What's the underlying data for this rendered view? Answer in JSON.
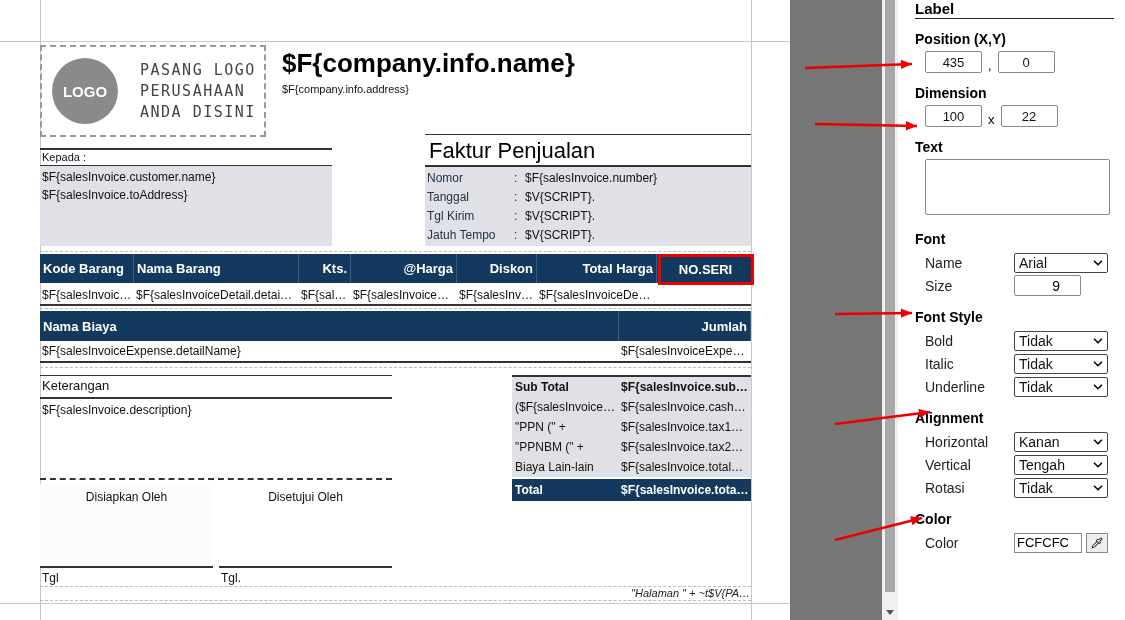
{
  "report": {
    "logo": {
      "badge": "LOGO",
      "lines": [
        "PASANG LOGO",
        "PERUSAHAAN",
        "ANDA DISINI"
      ]
    },
    "company": {
      "name": "$F{company.info.name}",
      "address": "$F{company.info.address}"
    },
    "recipient": {
      "label": "Kepada :",
      "lines": [
        "$F{salesInvoice.customer.name}",
        "$F{salesInvoice.toAddress}"
      ]
    },
    "invoice": {
      "title": "Faktur Penjualan",
      "fields": [
        {
          "label": "Nomor",
          "separator": ":",
          "value": "$F{salesInvoice.number}"
        },
        {
          "label": "Tanggal",
          "separator": ":",
          "value": "$V{SCRIPT}."
        },
        {
          "label": "Tgl Kirim",
          "separator": ":",
          "value": "$V{SCRIPT}."
        },
        {
          "label": "Jatuh Tempo",
          "separator": ":",
          "value": "$V{SCRIPT}."
        }
      ]
    },
    "detail_table": {
      "columns": [
        {
          "label": "Kode Barang",
          "kind": "text",
          "highlighted": false
        },
        {
          "label": "Nama Barang",
          "kind": "text",
          "highlighted": false
        },
        {
          "label": "Kts.",
          "kind": "amount",
          "highlighted": false
        },
        {
          "label": "@Harga",
          "kind": "amount",
          "highlighted": false
        },
        {
          "label": "Diskon",
          "kind": "amount",
          "highlighted": false
        },
        {
          "label": "Total Harga",
          "kind": "amount",
          "highlighted": false
        },
        {
          "label": "NO.SERI",
          "kind": "serial",
          "highlighted": true
        }
      ],
      "row": [
        "$F{salesInvoic…",
        "$F{salesInvoiceDetail.detai…",
        "$F{sal…",
        "$F{salesInvoice…",
        "$F{salesInv…",
        "$F{salesInvoiceDe…"
      ]
    },
    "expense_table": {
      "columns": [
        {
          "label": "Nama Biaya",
          "kind": "text"
        },
        {
          "label": "Jumlah",
          "kind": "amount"
        }
      ],
      "row": [
        "$F{salesInvoiceExpense.detailName}",
        "$F{salesInvoiceExpe…"
      ]
    },
    "notes": {
      "label": "Keterangan",
      "value": "$F{salesInvoice.description}"
    },
    "signatures": [
      {
        "title": "Disiapkan Oleh",
        "date_label": "Tgl"
      },
      {
        "title": "Disetujui Oleh",
        "date_label": "Tgl."
      }
    ],
    "totals": [
      {
        "kind": "bold",
        "label": "Sub Total",
        "value": "$F{salesInvoice.sub…"
      },
      {
        "kind": "plain",
        "label": "($F{salesInvoice…",
        "value": "$F{salesInvoice.cash…"
      },
      {
        "kind": "plain",
        "label": "\"PPN (\" +",
        "value": "$F{salesInvoice.tax1…"
      },
      {
        "kind": "plain",
        "label": "\"PPNBM (\" +",
        "value": "$F{salesInvoice.tax2…"
      },
      {
        "kind": "plain",
        "label": "Biaya Lain-lain",
        "value": "$F{salesInvoice.total…"
      },
      {
        "kind": "total",
        "label": "Total",
        "value": "$F{salesInvoice.tota…"
      }
    ],
    "footer": "\"Halaman \" +  ~t$V{PA…"
  },
  "properties": {
    "title": "Label",
    "sections": [
      {
        "kind": "pair",
        "heading": "Position (X,Y)",
        "first": "435",
        "separator": ",",
        "second": "0"
      },
      {
        "kind": "pair",
        "heading": "Dimension",
        "first": "100",
        "separator": "x",
        "second": "22"
      },
      {
        "kind": "textarea",
        "heading": "Text"
      },
      {
        "kind": "rows",
        "heading": "Font",
        "rows": [
          {
            "kind": "select",
            "label": "Name",
            "value": "Arial"
          },
          {
            "kind": "input",
            "label": "Size",
            "value": "9"
          }
        ]
      },
      {
        "kind": "rows",
        "heading": "Font Style",
        "rows": [
          {
            "kind": "select",
            "label": "Bold",
            "value": "Tidak"
          },
          {
            "kind": "select",
            "label": "Italic",
            "value": "Tidak"
          },
          {
            "kind": "select",
            "label": "Underline",
            "value": "Tidak"
          }
        ]
      },
      {
        "kind": "rows",
        "heading": "Alignment",
        "rows": [
          {
            "kind": "select",
            "label": "Horizontal",
            "value": "Kanan"
          },
          {
            "kind": "select",
            "label": "Vertical",
            "value": "Tengah"
          },
          {
            "kind": "select",
            "label": "Rotasi",
            "value": "Tidak"
          }
        ]
      },
      {
        "kind": "rows",
        "heading": "Color",
        "rows": [
          {
            "kind": "color",
            "label": "Color",
            "value": "FCFCFC"
          }
        ]
      }
    ]
  }
}
